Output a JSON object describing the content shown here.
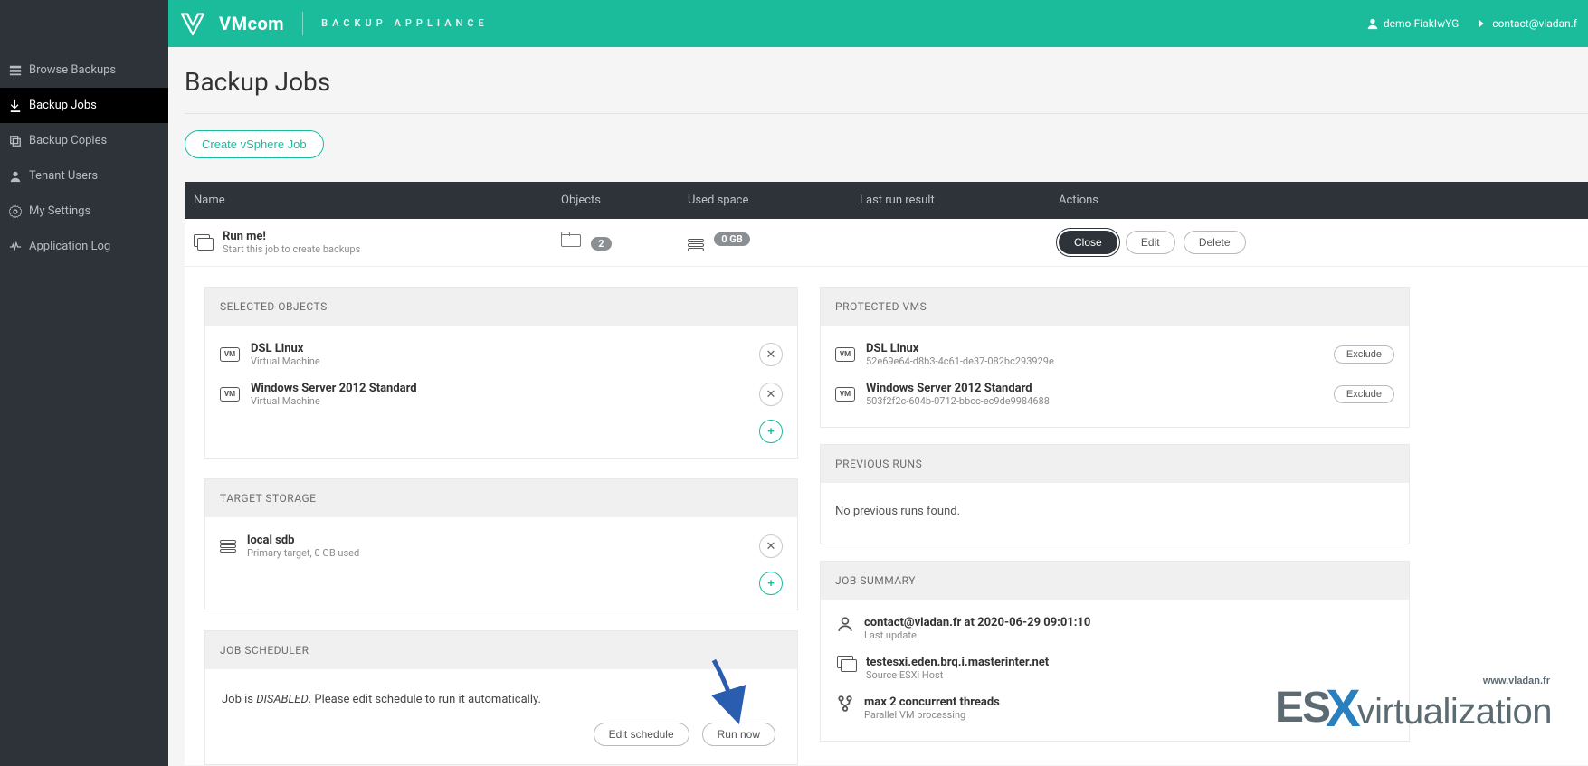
{
  "brand": {
    "name": "VMcom",
    "subtitle": "BACKUP APPLIANCE"
  },
  "user": {
    "demo": "demo-FiakIwYG",
    "contact": "contact@vladan.f"
  },
  "sidebar": {
    "items": [
      {
        "label": "Browse Backups"
      },
      {
        "label": "Backup Jobs"
      },
      {
        "label": "Backup Copies"
      },
      {
        "label": "Tenant Users"
      },
      {
        "label": "My Settings"
      },
      {
        "label": "Application Log"
      }
    ]
  },
  "page": {
    "title": "Backup Jobs",
    "create_btn": "Create vSphere Job"
  },
  "columns": {
    "name": "Name",
    "objects": "Objects",
    "used": "Used space",
    "last": "Last run result",
    "actions": "Actions"
  },
  "job": {
    "name": "Run me!",
    "hint": "Start this job to create backups",
    "object_count": "2",
    "used_space": "0 GB",
    "btn_close": "Close",
    "btn_edit": "Edit",
    "btn_delete": "Delete"
  },
  "selected": {
    "heading": "SELECTED OBJECTS",
    "items": [
      {
        "name": "DSL Linux",
        "sub": "Virtual Machine"
      },
      {
        "name": "Windows Server 2012 Standard",
        "sub": "Virtual Machine"
      }
    ]
  },
  "storage": {
    "heading": "TARGET STORAGE",
    "items": [
      {
        "name": "local sdb",
        "sub": "Primary target, 0 GB used"
      }
    ]
  },
  "scheduler": {
    "heading": "JOB SCHEDULER",
    "text_pre": "Job is ",
    "text_em": "DISABLED",
    "text_post": ". Please edit schedule to run it automatically.",
    "btn_edit": "Edit schedule",
    "btn_run": "Run now"
  },
  "protected": {
    "heading": "PROTECTED VMS",
    "btn_exclude": "Exclude",
    "items": [
      {
        "name": "DSL Linux",
        "sub": "52e69e64-d8b3-4c61-de37-082bc293929e"
      },
      {
        "name": "Windows Server 2012 Standard",
        "sub": "503f2f2c-604b-0712-bbcc-ec9de9984688"
      }
    ]
  },
  "previous": {
    "heading": "PREVIOUS RUNS",
    "empty": "No previous runs found."
  },
  "summary": {
    "heading": "JOB SUMMARY",
    "items": [
      {
        "t": "contact@vladan.fr at 2020-06-29 09:01:10",
        "s": "Last update"
      },
      {
        "t": "testesxi.eden.brq.i.masterinter.net",
        "s": "Source ESXi Host"
      },
      {
        "t": "max 2 concurrent threads",
        "s": "Parallel VM processing"
      }
    ]
  },
  "watermark": {
    "site": "www.vladan.fr",
    "es": "ES",
    "x": "X",
    "virt": "virtualization"
  }
}
